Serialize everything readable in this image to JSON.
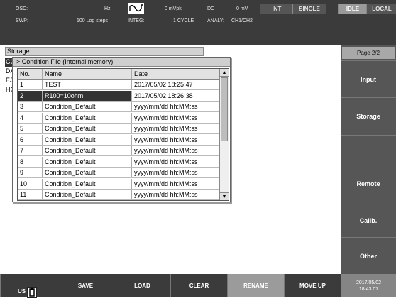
{
  "status": {
    "osc_label": "OSC:",
    "osc_unit": "Hz",
    "osc_amplitude": "0 mVpk",
    "dc_label": "DC",
    "dc_value": "0 mV",
    "swp_label": "SWP:",
    "swp_value": "100 Log steps",
    "integ_label": "INTEG:",
    "integ_value": "1 CYCLE",
    "analy_label": "ANALY:",
    "analy_value": "CH1/CH2",
    "int_button": "INT",
    "single_button": "SINGLE",
    "idle_button": "IDLE",
    "local_button": "LOCAL"
  },
  "storage": {
    "title": "Storage",
    "behind_items": [
      "CC",
      "DA",
      "EJ",
      "HC"
    ]
  },
  "dialog": {
    "title": "> Condition File (Internal memory)",
    "columns": [
      "No.",
      "Name",
      "Date"
    ],
    "rows": [
      {
        "no": "1",
        "name": "TEST",
        "date": "2017/05/02 18:25:47"
      },
      {
        "no": "2",
        "name": "R100=10ohm",
        "date": "2017/05/02 18:26:38"
      },
      {
        "no": "3",
        "name": "Condition_Default",
        "date": "yyyy/mm/dd hh:MM:ss"
      },
      {
        "no": "4",
        "name": "Condition_Default",
        "date": "yyyy/mm/dd hh:MM:ss"
      },
      {
        "no": "5",
        "name": "Condition_Default",
        "date": "yyyy/mm/dd hh:MM:ss"
      },
      {
        "no": "6",
        "name": "Condition_Default",
        "date": "yyyy/mm/dd hh:MM:ss"
      },
      {
        "no": "7",
        "name": "Condition_Default",
        "date": "yyyy/mm/dd hh:MM:ss"
      },
      {
        "no": "8",
        "name": "Condition_Default",
        "date": "yyyy/mm/dd hh:MM:ss"
      },
      {
        "no": "9",
        "name": "Condition_Default",
        "date": "yyyy/mm/dd hh:MM:ss"
      },
      {
        "no": "10",
        "name": "Condition_Default",
        "date": "yyyy/mm/dd hh:MM:ss"
      },
      {
        "no": "11",
        "name": "Condition_Default",
        "date": "yyyy/mm/dd hh:MM:ss"
      }
    ]
  },
  "fpanel": {
    "page": "Page 2/2",
    "keys": [
      "Input",
      "Storage",
      "",
      "Remote",
      "Calib.",
      "Other"
    ]
  },
  "bottom": {
    "usb_label": "US",
    "keys": [
      "SAVE",
      "LOAD",
      "CLEAR",
      "RENAME",
      "MOVE UP"
    ],
    "date": "2017/05/02",
    "time": "18:43:07"
  },
  "icons": {
    "waveform": "sine-wave-icon",
    "usb": "usb-memory-icon",
    "scroll_up": "triangle-up-icon",
    "scroll_down": "triangle-down-icon"
  }
}
